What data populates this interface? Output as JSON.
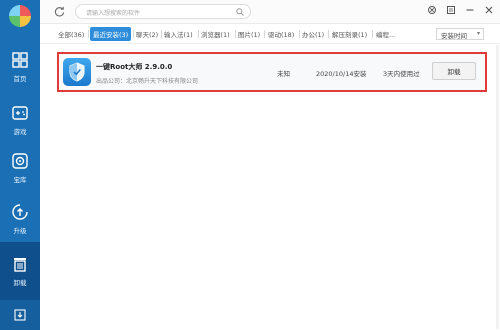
{
  "sidebar": {
    "items": [
      {
        "label": "首页",
        "icon": "home-icon"
      },
      {
        "label": "游戏",
        "icon": "gamepad-icon"
      },
      {
        "label": "宝库",
        "icon": "treasure-icon"
      },
      {
        "label": "升级",
        "icon": "upgrade-icon"
      },
      {
        "label": "卸载",
        "icon": "trash-icon"
      }
    ],
    "bottom_icon": "download-icon",
    "colors": {
      "bg": "#1a6fb5",
      "active": "#0f4f8c"
    }
  },
  "topbar": {
    "search": {
      "placeholder": "请输入想搜索的软件"
    },
    "window_buttons": [
      "settings-icon",
      "menu-icon",
      "minimize-icon",
      "close-icon"
    ]
  },
  "tabs": [
    {
      "label": "全部(36)",
      "active": false
    },
    {
      "label": "最近安装(3)",
      "active": true
    },
    {
      "label": "聊天(2)",
      "active": false
    },
    {
      "label": "输入法(1)",
      "active": false
    },
    {
      "label": "浏览器(1)",
      "active": false
    },
    {
      "label": "图片(1)",
      "active": false
    },
    {
      "label": "驱动(18)",
      "active": false
    },
    {
      "label": "办公(1)",
      "active": false
    },
    {
      "label": "解压刻录(1)",
      "active": false
    },
    {
      "label": "编程...",
      "active": false
    }
  ],
  "sort": {
    "label": "安装时间",
    "arrow": "▾"
  },
  "apps": [
    {
      "name": "一键Root大师 2.9.0.0",
      "publisher": "出品公司：北京畅升天下科技有限公司",
      "size": "未知",
      "installed": "2020/10/14安装",
      "usage": "3天内使用过",
      "action": "卸载"
    }
  ],
  "accent_color": "#2d8ddb",
  "highlight_color": "#e03a3a"
}
